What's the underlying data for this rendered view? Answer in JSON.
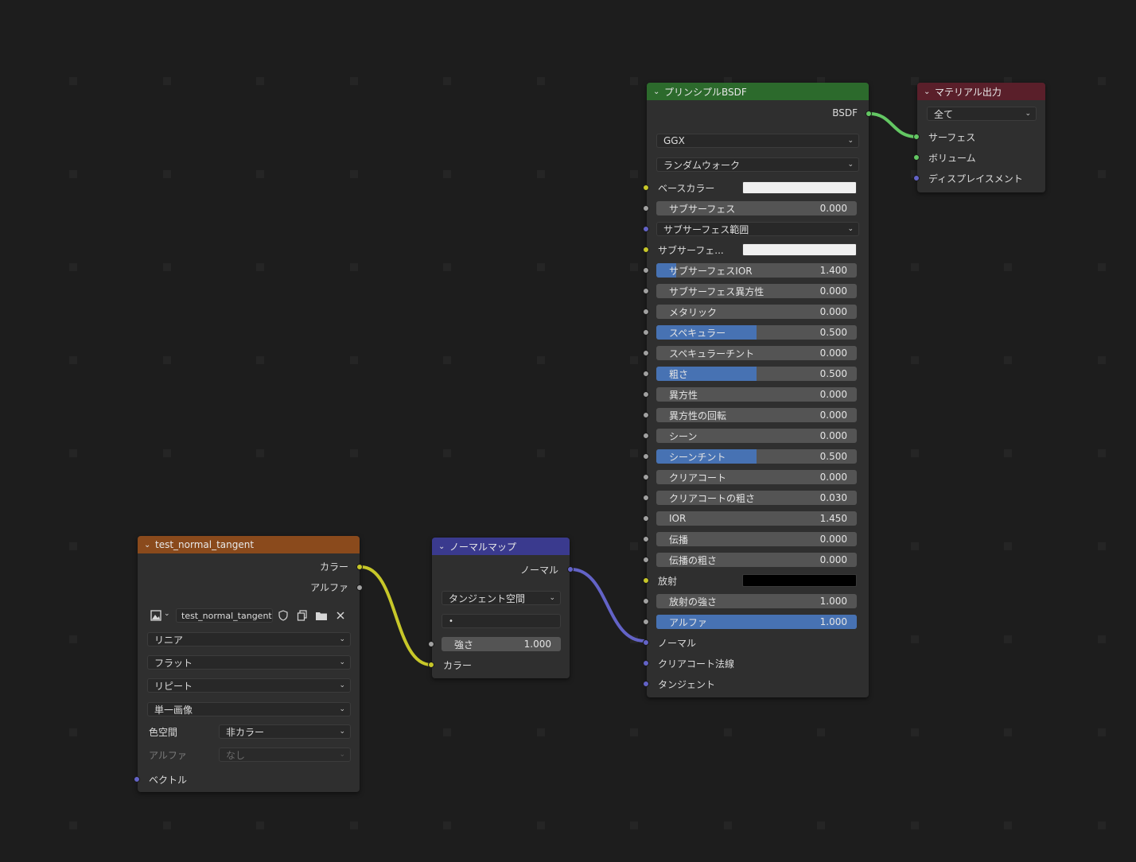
{
  "colors": {
    "background": "#1d1d1d",
    "node_body": "#2f2f2f",
    "header_image": "#8a4a1c",
    "header_vector": "#3a3a8e",
    "header_shader": "#2c6a2c",
    "header_output": "#5a1f2a",
    "slider_fill": "#4772b3",
    "socket_color": "#c7c729",
    "socket_float": "#a1a1a1",
    "socket_vector": "#6363c7",
    "socket_shader": "#63c763"
  },
  "image_node": {
    "title": "test_normal_tangent",
    "out_color": "カラー",
    "out_alpha": "アルファ",
    "image_name": "test_normal_tangent",
    "interpolation": "リニア",
    "projection": "フラット",
    "extension": "リピート",
    "source": "単一画像",
    "colorspace_label": "色空間",
    "colorspace_value": "非カラー",
    "alpha_label": "アルファ",
    "alpha_value": "なし",
    "in_vector": "ベクトル",
    "icons": [
      "image-icon",
      "shield-icon",
      "duplicate-icon",
      "folder-icon",
      "close-icon"
    ]
  },
  "normal_node": {
    "title": "ノーマルマップ",
    "out_normal": "ノーマル",
    "space": "タンジェント空間",
    "uv_map": "",
    "strength_label": "強さ",
    "strength_value": "1.000",
    "strength_fraction": 0,
    "in_color": "カラー"
  },
  "bsdf_node": {
    "title": "プリンシプルBSDF",
    "out_bsdf": "BSDF",
    "distribution": "GGX",
    "subsurface_method": "ランダムウォーク",
    "rows": [
      {
        "kind": "color",
        "label": "ベースカラー",
        "color": "#f0f0f0",
        "socket": "yellow"
      },
      {
        "kind": "slider",
        "label": "サブサーフェス",
        "value": "0.000",
        "fraction": 0,
        "socket": "grey"
      },
      {
        "kind": "dropdown",
        "label": "サブサーフェス範囲",
        "socket": "purple"
      },
      {
        "kind": "color",
        "label": "サブサーフェ...",
        "color": "#f0f0f0",
        "socket": "yellow"
      },
      {
        "kind": "slider",
        "label": "サブサーフェスIOR",
        "value": "1.400",
        "fraction": 0.1,
        "socket": "grey"
      },
      {
        "kind": "slider",
        "label": "サブサーフェス異方性",
        "value": "0.000",
        "fraction": 0,
        "socket": "grey"
      },
      {
        "kind": "slider",
        "label": "メタリック",
        "value": "0.000",
        "fraction": 0,
        "socket": "grey"
      },
      {
        "kind": "slider",
        "label": "スペキュラー",
        "value": "0.500",
        "fraction": 0.5,
        "socket": "grey"
      },
      {
        "kind": "slider",
        "label": "スペキュラーチント",
        "value": "0.000",
        "fraction": 0,
        "socket": "grey"
      },
      {
        "kind": "slider",
        "label": "粗さ",
        "value": "0.500",
        "fraction": 0.5,
        "socket": "grey"
      },
      {
        "kind": "slider",
        "label": "異方性",
        "value": "0.000",
        "fraction": 0,
        "socket": "grey"
      },
      {
        "kind": "slider",
        "label": "異方性の回転",
        "value": "0.000",
        "fraction": 0,
        "socket": "grey"
      },
      {
        "kind": "slider",
        "label": "シーン",
        "value": "0.000",
        "fraction": 0,
        "socket": "grey"
      },
      {
        "kind": "slider",
        "label": "シーンチント",
        "value": "0.500",
        "fraction": 0.5,
        "socket": "grey"
      },
      {
        "kind": "slider",
        "label": "クリアコート",
        "value": "0.000",
        "fraction": 0,
        "socket": "grey"
      },
      {
        "kind": "slider",
        "label": "クリアコートの粗さ",
        "value": "0.030",
        "fraction": 0,
        "socket": "grey"
      },
      {
        "kind": "slider",
        "label": "IOR",
        "value": "1.450",
        "fraction": 0,
        "socket": "grey"
      },
      {
        "kind": "slider",
        "label": "伝播",
        "value": "0.000",
        "fraction": 0,
        "socket": "grey"
      },
      {
        "kind": "slider",
        "label": "伝播の粗さ",
        "value": "0.000",
        "fraction": 0,
        "socket": "grey"
      },
      {
        "kind": "color",
        "label": "放射",
        "color": "#000000",
        "socket": "yellow"
      },
      {
        "kind": "slider",
        "label": "放射の強さ",
        "value": "1.000",
        "fraction": 0,
        "socket": "grey"
      },
      {
        "kind": "slider",
        "label": "アルファ",
        "value": "1.000",
        "fraction": 1,
        "socket": "grey"
      },
      {
        "kind": "plain",
        "label": "ノーマル",
        "socket": "purple"
      },
      {
        "kind": "plain",
        "label": "クリアコート法線",
        "socket": "purple"
      },
      {
        "kind": "plain",
        "label": "タンジェント",
        "socket": "purple"
      }
    ]
  },
  "output_node": {
    "title": "マテリアル出力",
    "target": "全て",
    "in_surface": "サーフェス",
    "in_volume": "ボリューム",
    "in_displacement": "ディスプレイスメント"
  }
}
